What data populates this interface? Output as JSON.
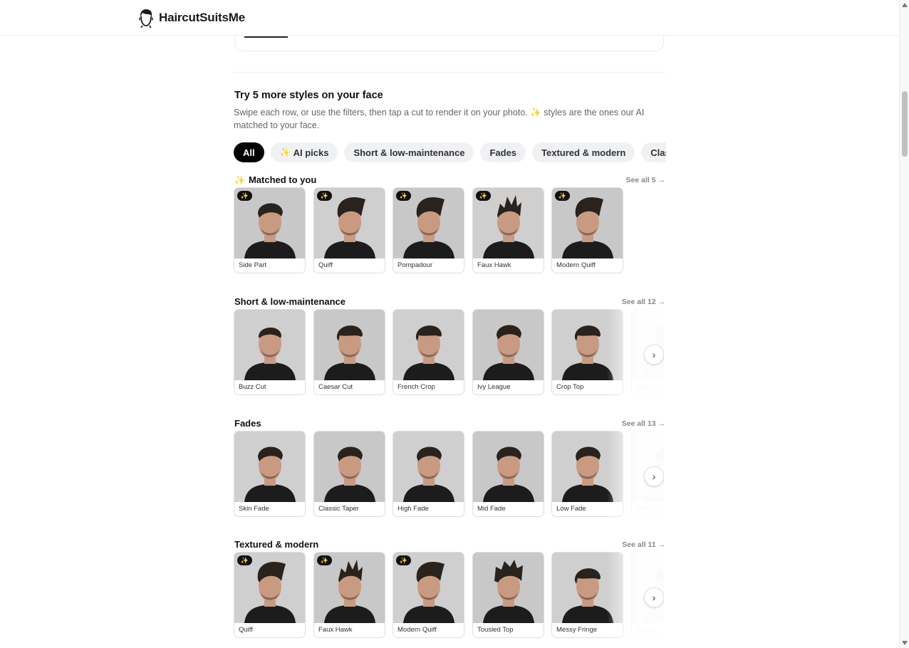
{
  "brand": {
    "name": "HaircutSuitsMe",
    "icon": "man-face-icon"
  },
  "section": {
    "heading": "Try 5 more styles on your face",
    "subtext": "Swipe each row, or use the filters, then tap a cut to render it on your photo. ✨ styles are the ones our AI matched to your face."
  },
  "filters": [
    "All",
    "AI picks",
    "Short & low-maintenance",
    "Fades",
    "Textured & modern",
    "Classic"
  ],
  "sparkle": "✨",
  "next_arrow": "›",
  "rows": [
    {
      "title": "Matched to you",
      "see_all": "See all 5 →",
      "items": [
        {
          "label": "Side Part",
          "ai": true
        },
        {
          "label": "Quiff",
          "ai": true
        },
        {
          "label": "Pompadour",
          "ai": true
        },
        {
          "label": "Faux Hawk",
          "ai": true
        },
        {
          "label": "Modern Quiff",
          "ai": true
        }
      ]
    },
    {
      "title": "Short & low-maintenance",
      "see_all": "See all 12 →",
      "items": [
        {
          "label": "Buzz Cut"
        },
        {
          "label": "Caesar Cut"
        },
        {
          "label": "French Crop"
        },
        {
          "label": "Ivy League"
        },
        {
          "label": "Crop Top"
        },
        {
          "label": "Grey Cr"
        }
      ]
    },
    {
      "title": "Fades",
      "see_all": "See all 13 →",
      "items": [
        {
          "label": "Skin Fade"
        },
        {
          "label": "Classic Taper"
        },
        {
          "label": "High Fade"
        },
        {
          "label": "Mid Fade"
        },
        {
          "label": "Low Fade"
        },
        {
          "label": "Drop Fa"
        }
      ]
    },
    {
      "title": "Textured & modern",
      "see_all": "See all 11 →",
      "items": [
        {
          "label": "Quiff",
          "ai": true
        },
        {
          "label": "Faux Hawk",
          "ai": true
        },
        {
          "label": "Modern Quiff",
          "ai": true
        },
        {
          "label": "Tousled Top"
        },
        {
          "label": "Messy Fringe"
        },
        {
          "label": "Textur"
        }
      ]
    }
  ]
}
